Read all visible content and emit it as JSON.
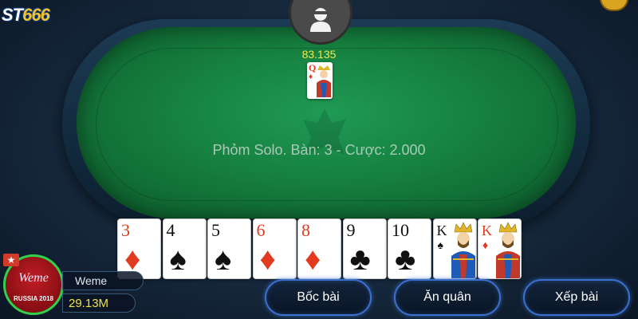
{
  "brand": {
    "logo_prefix": "ST",
    "logo_number": "666"
  },
  "table": {
    "info": "Phỏm Solo. Bàn: 3 - Cược: 2.000"
  },
  "opponent": {
    "money": "83.135",
    "card": {
      "rank": "Q",
      "suit": "♦",
      "color": "red"
    }
  },
  "player": {
    "name": "Weme",
    "money": "29.13M",
    "avatar_caption": "RUSSIA 2018",
    "avatar_top": "Weme"
  },
  "hand": [
    {
      "rank": "3",
      "suit": "♦",
      "color": "red",
      "face": false
    },
    {
      "rank": "4",
      "suit": "♠",
      "color": "blk",
      "face": false
    },
    {
      "rank": "5",
      "suit": "♠",
      "color": "blk",
      "face": false
    },
    {
      "rank": "6",
      "suit": "♦",
      "color": "red",
      "face": false
    },
    {
      "rank": "8",
      "suit": "♦",
      "color": "red",
      "face": false
    },
    {
      "rank": "9",
      "suit": "♣",
      "color": "blk",
      "face": false
    },
    {
      "rank": "10",
      "suit": "♣",
      "color": "blk",
      "face": false
    },
    {
      "rank": "K",
      "suit": "♠",
      "color": "blk",
      "face": true
    },
    {
      "rank": "K",
      "suit": "♦",
      "color": "red",
      "face": true
    }
  ],
  "actions": {
    "draw": "Bốc bài",
    "take": "Ăn quân",
    "arrange": "Xếp bài"
  },
  "colors": {
    "felt": "#16803f",
    "money": "#f0e24a",
    "button_border": "#3b6fd0"
  }
}
